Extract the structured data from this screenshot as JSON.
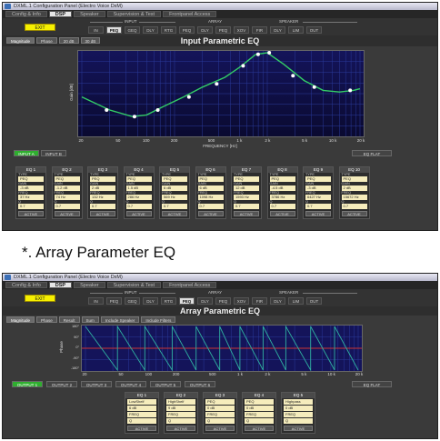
{
  "colors": {
    "exit_button": "#f6f000",
    "active_input": "#2fae2f",
    "value_field": "#f5ecbc",
    "graph_bg_1": "#14145a",
    "graph_bg_2": "#0a0a30",
    "curve": "#33cc66",
    "flat_line": "#cc3333"
  },
  "panel1": {
    "window_title": "DXML.1 Configuration Panel (Electro Voice DxM)",
    "menu": [
      "Config & Info",
      "DSP",
      "Speaker",
      "Supervision & Test",
      "Frontpanel Access"
    ],
    "active_menu": 1,
    "exit_label": "EXIT",
    "group_labels": {
      "input": "INPUT",
      "array": "ARRAY",
      "speaker": "SPEAKER"
    },
    "nav_tabs": [
      "IN",
      "PEQ",
      "GEQ",
      "DLY",
      "RTG",
      "PEQ",
      "DLY",
      "PEQ",
      "XOV",
      "FIR",
      "DLY",
      "LIM",
      "OUT"
    ],
    "active_nav": 1,
    "title": "Input Parametric EQ",
    "view_tabs": [
      "Magnitude",
      "Phase",
      "20 dB",
      "30 dB"
    ],
    "y_axis_label": "Gain [dB]",
    "x_axis_label": "FREQUENCY [Hz]",
    "x_ticks": [
      "20",
      "50",
      "100",
      "200",
      "500",
      "1 k",
      "2 k",
      "5 k",
      "10 k",
      "20 k"
    ],
    "input_buttons": [
      "INPUT A",
      "INPUT B"
    ],
    "eq_flat_label": "EQ FLAT",
    "field_labels": {
      "type": "TYPE",
      "gain": "GAIN",
      "freq": "FREQ",
      "q": "Q",
      "active": "ACTIVE"
    },
    "bands": [
      {
        "name": "EQ 1",
        "type": "PEQ",
        "gain": "-3 dB",
        "freq": "37 Hz",
        "q": "0.7"
      },
      {
        "name": "EQ 2",
        "type": "PEQ",
        "gain": "-1.2 dB",
        "freq": "74 Hz",
        "q": "0.7"
      },
      {
        "name": "EQ 3",
        "type": "PEQ",
        "gain": "2 dB",
        "freq": "132 Hz",
        "q": "0.7"
      },
      {
        "name": "EQ 4",
        "type": "PEQ",
        "gain": "1.5 dB",
        "freq": "286 Hz",
        "q": "0.7"
      },
      {
        "name": "EQ 5",
        "type": "PEQ",
        "gain": "6 dB",
        "freq": "569 Hz",
        "q": "0.7"
      },
      {
        "name": "EQ 6",
        "type": "PEQ",
        "gain": "6 dB",
        "freq": "1098 Hz",
        "q": "0.7"
      },
      {
        "name": "EQ 7",
        "type": "PEQ",
        "gain": "12 dB",
        "freq": "1593 Hz",
        "q": "0.7"
      },
      {
        "name": "EQ 8",
        "type": "PEQ",
        "gain": "-4.5 dB",
        "freq": "3786 Hz",
        "q": "0.7"
      },
      {
        "name": "EQ 9",
        "type": "PEQ",
        "gain": "-3 dB",
        "freq": "6427 Hz",
        "q": "0.7"
      },
      {
        "name": "EQ 10",
        "type": "PEQ",
        "gain": "2 dB",
        "freq": "15672 Hz",
        "q": "0.7"
      }
    ]
  },
  "caption": "*. Array Parameter EQ",
  "panel2": {
    "window_title": "DXML.1 Configuration Panel (Electro Voice DxM)",
    "menu": [
      "Config & Info",
      "DSP",
      "Speaker",
      "Supervision & Test",
      "Frontpanel Access"
    ],
    "active_menu": 1,
    "exit_label": "EXIT",
    "group_labels": {
      "input": "INPUT",
      "array": "ARRAY",
      "speaker": "SPEAKER"
    },
    "nav_tabs": [
      "IN",
      "PEQ",
      "GEQ",
      "DLY",
      "RTG",
      "PEQ",
      "DLY",
      "PEQ",
      "XOV",
      "FIR",
      "DLY",
      "LIM",
      "OUT"
    ],
    "active_nav": 5,
    "title": "Array Parametric EQ",
    "view_tabs": [
      "Magnitude",
      "Phase",
      "Result",
      "Sum",
      "Include Speaker",
      "Include Filters"
    ],
    "y_axis_label": "Phase",
    "y_ticks": [
      "180°",
      "90°",
      "0°",
      "-90°",
      "-180°"
    ],
    "x_ticks": [
      "20",
      "50",
      "100",
      "200",
      "500",
      "1 k",
      "2 k",
      "5 k",
      "10 k",
      "20 k"
    ],
    "output_buttons": [
      "OUTPUT 1",
      "OUTPUT 2",
      "OUTPUT 3",
      "OUTPUT 4",
      "OUTPUT 5",
      "OUTPUT 6"
    ],
    "eq_flat_label": "EQ FLAT",
    "bands": [
      {
        "name": "EQ 1",
        "field1": "LowShelf",
        "field2": "6 dB",
        "field3": "FREQ",
        "field4": "Q",
        "field5": "ACTIVE"
      },
      {
        "name": "EQ 2",
        "field1": "HighShelf",
        "field2": "9 dB",
        "field3": "FREQ",
        "field4": "Q",
        "field5": "ACTIVE"
      },
      {
        "name": "EQ 3",
        "field1": "PEQ",
        "field2": "0 dB",
        "field3": "FREQ",
        "field4": "Q",
        "field5": "ACTIVE"
      },
      {
        "name": "EQ 4",
        "field1": "PEQ",
        "field2": "0 dB",
        "field3": "FREQ",
        "field4": "Q",
        "field5": "ACTIVE"
      },
      {
        "name": "EQ 5",
        "field1": "Highpass",
        "field2": "0 dB",
        "field3": "FREQ",
        "field4": "Q",
        "field5": "ACTIVE"
      }
    ]
  }
}
